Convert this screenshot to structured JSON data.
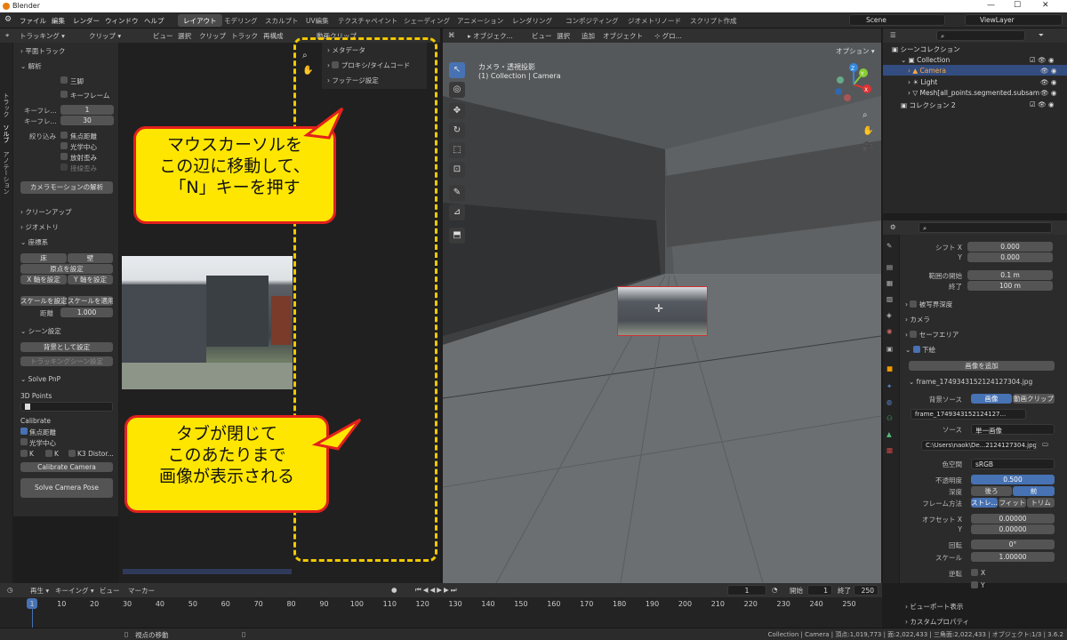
{
  "window": {
    "title": "Blender",
    "minimize": "—",
    "maximize": "☐",
    "close": "✕"
  },
  "menu": [
    "ファイル",
    "編集",
    "レンダー",
    "ウィンドウ",
    "ヘルプ"
  ],
  "workspaces": [
    "レイアウト",
    "モデリング",
    "スカルプト",
    "UV編集",
    "テクスチャペイント",
    "シェーディング",
    "アニメーション",
    "レンダリング",
    "コンポジティング",
    "ジオメトリノード",
    "スクリプト作成"
  ],
  "scene": "Scene",
  "view_layer": "ViewLayer",
  "clip_header": {
    "mode": "トラッキング",
    "view": "クリップ",
    "items": [
      "ビュー",
      "選択",
      "クリップ",
      "トラック",
      "再構成"
    ],
    "clip_name": "動画クリップ"
  },
  "clip_tabs": [
    "トラック",
    "ソルブ",
    "アノテーション"
  ],
  "clip_sidebar": {
    "plane_track": "平面トラック",
    "solve": "解析",
    "tripod": "三脚",
    "keyframe": "キーフレーム",
    "keyframe_a": {
      "label": "キーフレ...",
      "value": "1"
    },
    "keyframe_b": {
      "label": "キーフレ...",
      "value": "30"
    },
    "refine": "絞り込み",
    "focal": "焦点距離",
    "optical_center": "光学中心",
    "radial": "放射歪み",
    "tangential": "接線歪み",
    "solve_btn": "カメラモーションの解析",
    "cleanup": "クリーンアップ",
    "geometry": "ジオメトリ",
    "orientation": "座標系",
    "floor": "床",
    "wall": "壁",
    "set_origin": "原点を設定",
    "set_x": "X 軸を設定",
    "set_y": "Y 軸を設定",
    "set_scale": "スケールを設定",
    "apply_scale": "スケールを適用",
    "distance_label": "距離",
    "distance": "1.000",
    "scene_setup": "シーン設定",
    "set_bg": "背景として設定",
    "tracking_scene": "トラッキングシーン設定",
    "solve_pnp": "Solve PnP",
    "points_3d": "3D Points",
    "calibrate": "Calibrate",
    "cal_focal": "焦点距離",
    "cal_optical": "光学中心",
    "k1": "K",
    "k2": "K",
    "k3": "K3 Distor...",
    "calibrate_btn": "Calibrate Camera",
    "solve_pose_btn": "Solve Camera Pose"
  },
  "clip_npanel": {
    "metadata": "メタデータ",
    "proxy": "プロキシ/タイムコード",
    "footage": "フッテージ設定"
  },
  "viewport_header": {
    "mode": "オブジェク...",
    "items": [
      "ビュー",
      "選択",
      "追加",
      "オブジェクト"
    ],
    "transform": "グロ...",
    "options": "オプション"
  },
  "viewport": {
    "view_name": "カメラ・透視投影",
    "collection_info": "(1) Collection | Camera"
  },
  "gizmo": {
    "x": "X",
    "y": "Y",
    "z": "Z"
  },
  "callouts": {
    "top": "マウスカーソルを\nこの辺に移動して、\n「N」キーを押す",
    "bottom": "タブが閉じて\nこのあたりまで\n画像が表示される"
  },
  "outliner": {
    "title": "シーンコレクション",
    "items": [
      {
        "label": "Collection",
        "depth": 0
      },
      {
        "label": "Camera",
        "depth": 1
      },
      {
        "label": "Light",
        "depth": 1
      },
      {
        "label": "Mesh[all_points.segmented.subsam",
        "depth": 1
      },
      {
        "label": "コレクション 2",
        "depth": 0
      }
    ]
  },
  "properties": {
    "shift_x": {
      "label": "シフト X",
      "value": "0.000"
    },
    "shift_y": {
      "label": "Y",
      "value": "0.000"
    },
    "clip_start": {
      "label": "範囲の開始",
      "value": "0.1 m"
    },
    "clip_end": {
      "label": "終了",
      "value": "100 m"
    },
    "dof": "被写界深度",
    "camera": "カメラ",
    "safe_areas": "セーフエリア",
    "background": "下絵",
    "add_image": "画像を追加",
    "image_name": "frame_1749343152124127304.jpg",
    "bg_source_label": "背景ソース",
    "bg_image": "画像",
    "bg_clip": "動画クリップ",
    "image_block": "frame_1749343152124127...",
    "source_label": "ソース",
    "source_value": "単一画像",
    "filepath": "C:\\Users\\naok\\De...2124127304.jpg",
    "colorspace_label": "色空間",
    "colorspace": "sRGB",
    "opacity_label": "不透明度",
    "opacity": "0.500",
    "depth_label": "深度",
    "depth_back": "後ろ",
    "depth_front": "前",
    "frame_label": "フレーム方法",
    "frame_stretch": "ストレ...",
    "frame_fit": "フィット",
    "frame_crop": "トリム",
    "offset_x_label": "オフセット X",
    "offset_x": "0.00000",
    "offset_y_label": "Y",
    "offset_y": "0.00000",
    "rotation_label": "回転",
    "rotation": "0°",
    "scale_label": "スケール",
    "scale": "1.00000",
    "flip_label": "逆転",
    "flip_x": "X",
    "flip_y": "Y",
    "viewport_display": "ビューポート表示",
    "custom_props": "カスタムプロパティ"
  },
  "timeline": {
    "play": "再生",
    "keying": "キーイング",
    "view": "ビュー",
    "marker": "マーカー",
    "current": "1",
    "start_label": "開始",
    "start": "1",
    "end_label": "終了",
    "end": "250",
    "ticks": [
      "1",
      "10",
      "20",
      "30",
      "40",
      "50",
      "60",
      "70",
      "80",
      "90",
      "100",
      "110",
      "120",
      "130",
      "140",
      "150",
      "160",
      "170",
      "180",
      "190",
      "200",
      "210",
      "220",
      "230",
      "240",
      "250"
    ]
  },
  "statusbar": {
    "hint": "視点の移動",
    "stats": "Collection | Camera | 頂点:1,019,773 | 面:2,022,433 | 三角面:2,022,433 | オブジェクト:1/3 | 3.6.2"
  }
}
